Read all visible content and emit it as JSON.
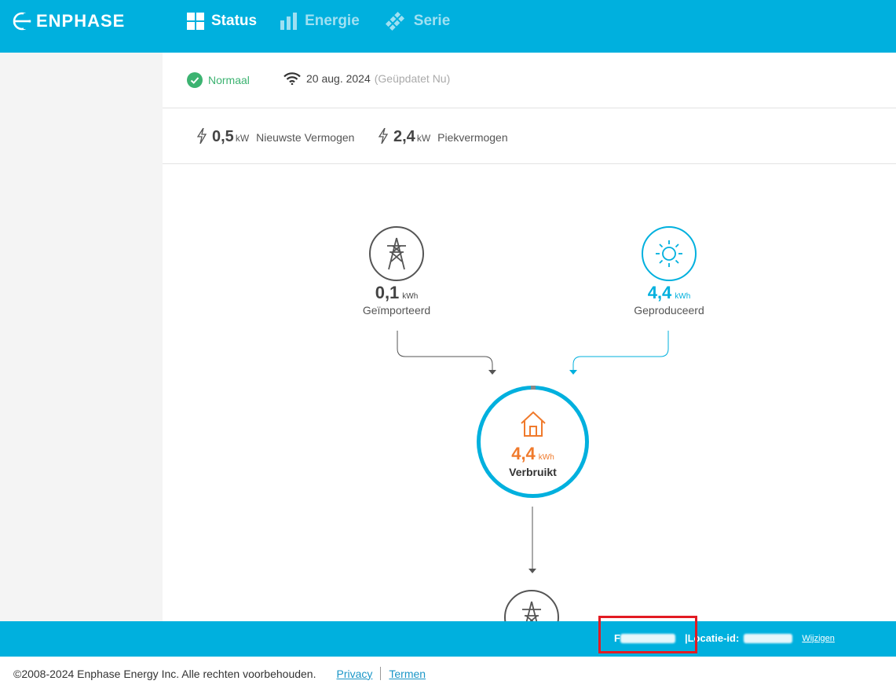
{
  "brand": {
    "name": "ENPHASE"
  },
  "nav": {
    "items": [
      {
        "label": "Status",
        "icon": "grid-icon",
        "active": true
      },
      {
        "label": "Energie",
        "icon": "bar-chart-icon",
        "active": false
      },
      {
        "label": "Serie",
        "icon": "solar-panel-icon",
        "active": false
      }
    ]
  },
  "status": {
    "state": "Normaal",
    "date": "20 aug. 2024",
    "updated": "(Geüpdatet Nu)"
  },
  "power": {
    "latest_value": "0,5",
    "latest_unit": "kW",
    "latest_label": "Nieuwste Vermogen",
    "peak_value": "2,4",
    "peak_unit": "kW",
    "peak_label": "Piekvermogen"
  },
  "flow": {
    "imported": {
      "value": "0,1",
      "unit": "kWh",
      "label": "Geïmporteerd"
    },
    "produced": {
      "value": "4,4",
      "unit": "kWh",
      "label": "Geproduceerd"
    },
    "consumed": {
      "value": "4,4",
      "unit": "kWh",
      "label": "Verbruikt"
    }
  },
  "colors": {
    "brand": "#00b0de",
    "grid": "#555555",
    "solar": "#00b0de",
    "consumption": "#f07a2c",
    "ok": "#3cb371"
  },
  "site": {
    "name_prefix": "F",
    "location_label": "|Locatie-id:",
    "change_link": "Wijzigen"
  },
  "footer": {
    "copyright": "©2008-2024 Enphase Energy Inc. Alle rechten voorbehouden.",
    "privacy": "Privacy",
    "terms": "Termen"
  }
}
